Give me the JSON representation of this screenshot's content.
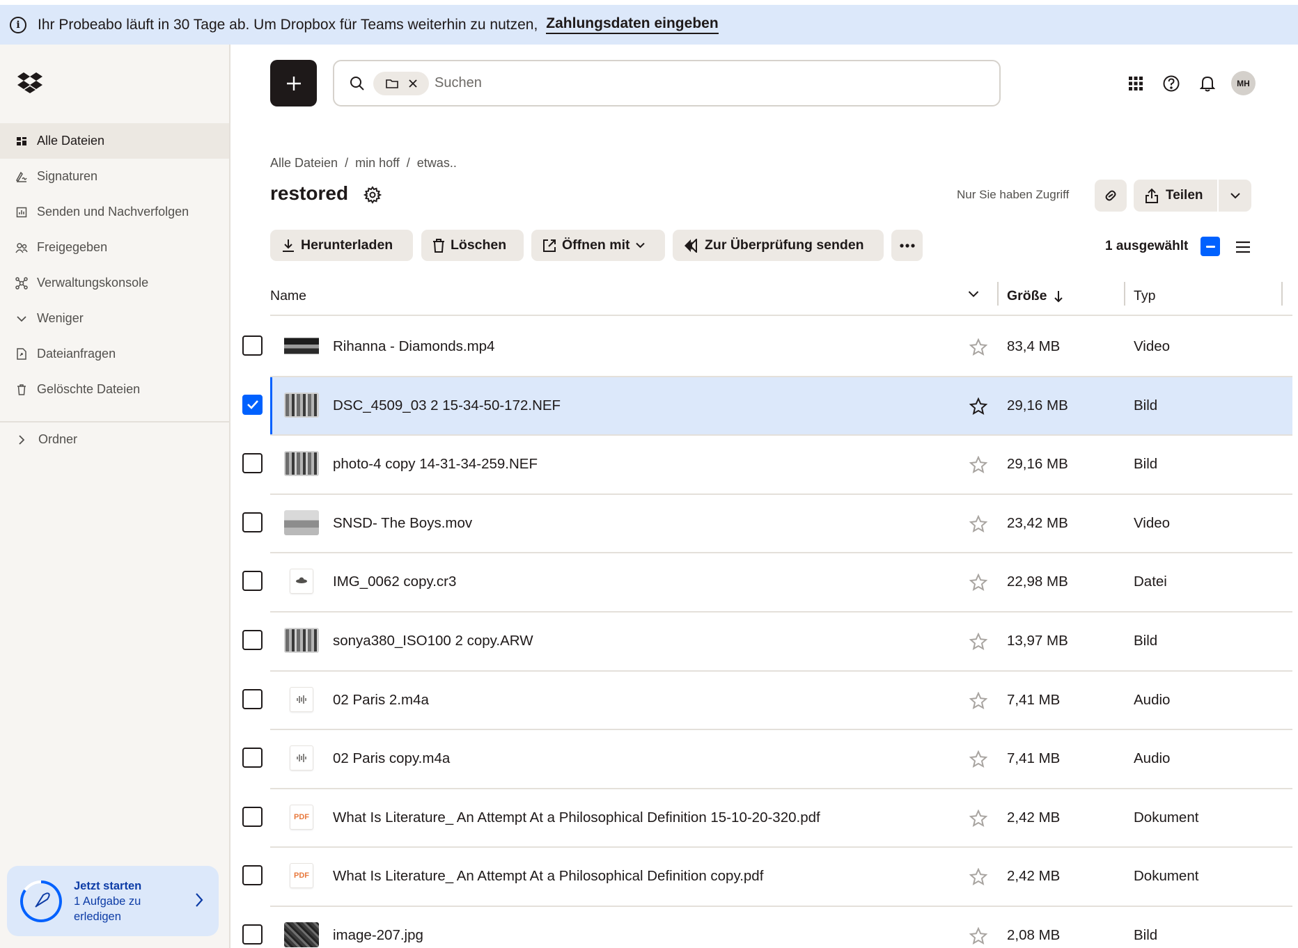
{
  "banner": {
    "text": "Ihr Probeabo läuft in 30 Tage ab. Um Dropbox für Teams weiterhin zu nutzen,",
    "link": "Zahlungsdaten eingeben"
  },
  "sidebar": {
    "items": [
      {
        "label": "Alle Dateien",
        "icon": "all-files-icon",
        "active": true
      },
      {
        "label": "Signaturen",
        "icon": "signature-icon"
      },
      {
        "label": "Senden und Nachverfolgen",
        "icon": "send-track-icon"
      },
      {
        "label": "Freigegeben",
        "icon": "shared-icon"
      },
      {
        "label": "Verwaltungskonsole",
        "icon": "admin-console-icon"
      },
      {
        "label": "Weniger",
        "icon": "chevron-down-icon"
      },
      {
        "label": "Dateianfragen",
        "icon": "file-request-icon"
      },
      {
        "label": "Gelöschte Dateien",
        "icon": "trash-icon"
      }
    ],
    "folders_label": "Ordner",
    "get_started": {
      "title": "Jetzt starten",
      "subtitle": "1 Aufgabe zu erledigen"
    }
  },
  "topbar": {
    "search_placeholder": "Suchen",
    "avatar_initials": "MH"
  },
  "breadcrumb": [
    "Alle Dateien",
    "min hoff",
    "etwas.."
  ],
  "page": {
    "title": "restored",
    "access": "Nur Sie haben Zugriff",
    "share_label": "Teilen"
  },
  "toolbar": {
    "download": "Herunterladen",
    "delete": "Löschen",
    "open_with": "Öffnen mit",
    "send_review": "Zur Überprüfung senden",
    "selected": "1 ausgewählt"
  },
  "table": {
    "col_name": "Name",
    "col_size": "Größe",
    "col_type": "Typ",
    "rows": [
      {
        "name": "Rihanna - Diamonds.mp4",
        "size": "83,4 MB",
        "type": "Video",
        "thumb": "video",
        "selected": false
      },
      {
        "name": "DSC_4509_03 2 15-34-50-172.NEF",
        "size": "29,16 MB",
        "type": "Bild",
        "thumb": "photo",
        "selected": true
      },
      {
        "name": "photo-4 copy 14-31-34-259.NEF",
        "size": "29,16 MB",
        "type": "Bild",
        "thumb": "photo",
        "selected": false
      },
      {
        "name": "SNSD- The Boys.mov",
        "size": "23,42 MB",
        "type": "Video",
        "thumb": "video2",
        "selected": false
      },
      {
        "name": "IMG_0062 copy.cr3",
        "size": "22,98 MB",
        "type": "Datei",
        "thumb": "file",
        "selected": false
      },
      {
        "name": "sonya380_ISO100 2 copy.ARW",
        "size": "13,97 MB",
        "type": "Bild",
        "thumb": "photo",
        "selected": false
      },
      {
        "name": "02 Paris 2.m4a",
        "size": "7,41 MB",
        "type": "Audio",
        "thumb": "audio",
        "selected": false
      },
      {
        "name": "02 Paris copy.m4a",
        "size": "7,41 MB",
        "type": "Audio",
        "thumb": "audio",
        "selected": false
      },
      {
        "name": "What Is Literature_ An Attempt At a Philosophical Definition 15-10-20-320.pdf",
        "size": "2,42 MB",
        "type": "Dokument",
        "thumb": "pdf",
        "selected": false
      },
      {
        "name": "What Is Literature_ An Attempt At a Philosophical Definition copy.pdf",
        "size": "2,42 MB",
        "type": "Dokument",
        "thumb": "pdf",
        "selected": false
      },
      {
        "name": "image-207.jpg",
        "size": "2,08 MB",
        "type": "Bild",
        "thumb": "dark",
        "selected": false
      }
    ],
    "pdf_label": "PDF"
  },
  "colors": {
    "accent": "#0061fe",
    "banner_bg": "#dce8fa",
    "sidebar_bg": "#f7f5f2",
    "selected_row_bg": "#dce8fa"
  }
}
